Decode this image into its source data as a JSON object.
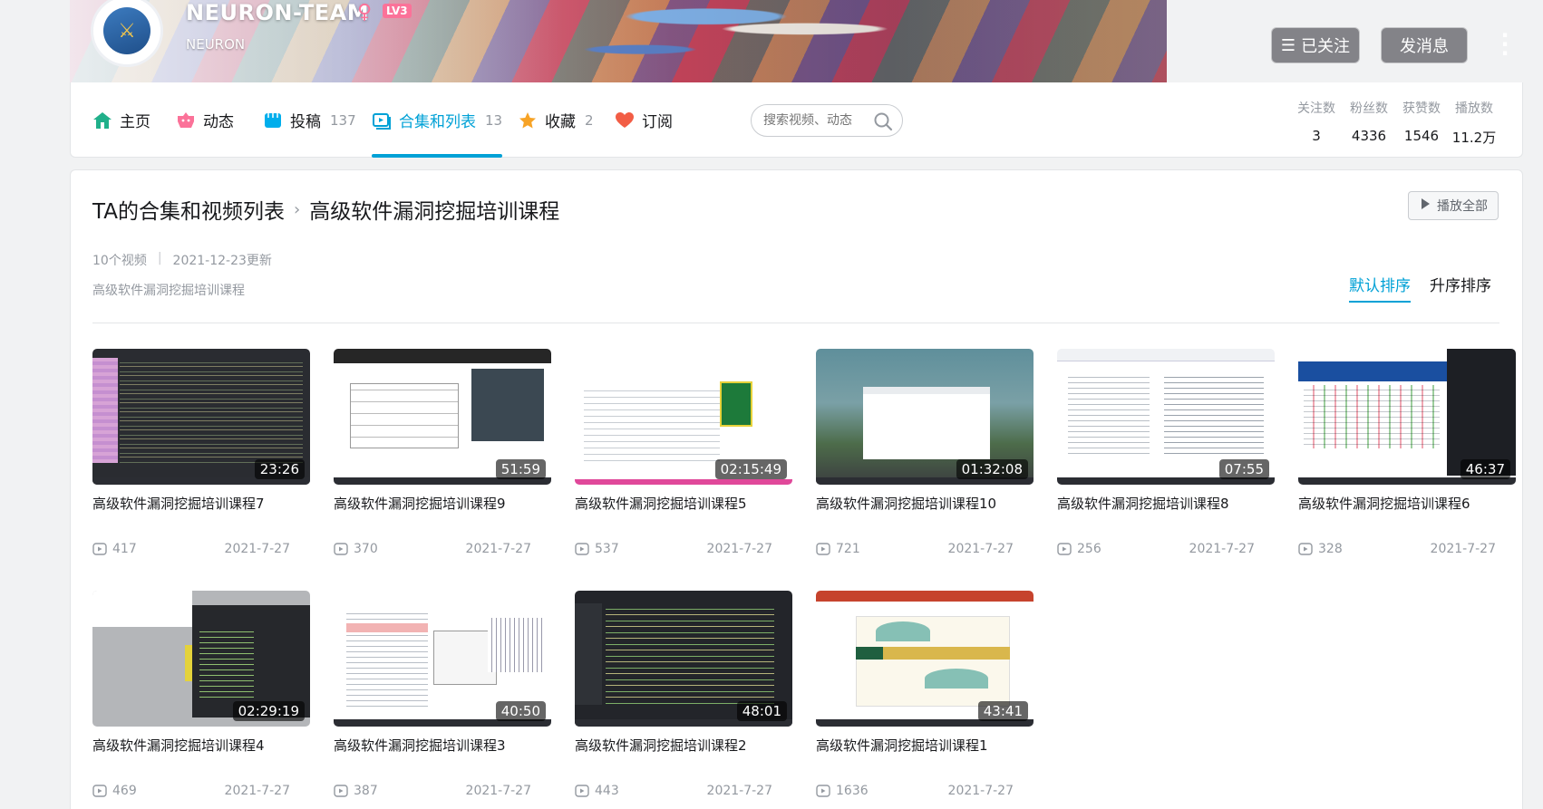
{
  "header": {
    "username": "NEURON-TEAM",
    "level": "LV3",
    "sign": "NEURON",
    "follow_label": "已关注",
    "message_label": "发消息"
  },
  "nav": {
    "items": [
      {
        "label": "主页",
        "count": "",
        "icon": "home-icon"
      },
      {
        "label": "动态",
        "count": "",
        "icon": "feed-icon"
      },
      {
        "label": "投稿",
        "count": "137",
        "icon": "upload-icon"
      },
      {
        "label": "合集和列表",
        "count": "13",
        "icon": "collection-icon",
        "active": true
      },
      {
        "label": "收藏",
        "count": "2",
        "icon": "star-icon"
      },
      {
        "label": "订阅",
        "count": "",
        "icon": "heart-icon"
      }
    ],
    "search_placeholder": "搜索视频、动态"
  },
  "stats": [
    {
      "label": "关注数",
      "value": "3"
    },
    {
      "label": "粉丝数",
      "value": "4336"
    },
    {
      "label": "获赞数",
      "value": "1546"
    },
    {
      "label": "播放数",
      "value": "11.2万"
    }
  ],
  "collection": {
    "breadcrumb_parent": "TA的合集和视频列表",
    "breadcrumb_current": "高级软件漏洞挖掘培训课程",
    "play_all_label": "播放全部",
    "video_count": "10个视频",
    "updated": "2021-12-23更新",
    "description": "高级软件漏洞挖掘培训课程",
    "sort_default": "默认排序",
    "sort_asc": "升序排序"
  },
  "videos": [
    {
      "title": "高级软件漏洞挖掘培训课程7",
      "duration": "23:26",
      "plays": "417",
      "date": "2021-7-27"
    },
    {
      "title": "高级软件漏洞挖掘培训课程9",
      "duration": "51:59",
      "plays": "370",
      "date": "2021-7-27"
    },
    {
      "title": "高级软件漏洞挖掘培训课程5",
      "duration": "02:15:49",
      "plays": "537",
      "date": "2021-7-27"
    },
    {
      "title": "高级软件漏洞挖掘培训课程10",
      "duration": "01:32:08",
      "plays": "721",
      "date": "2021-7-27"
    },
    {
      "title": "高级软件漏洞挖掘培训课程8",
      "duration": "07:55",
      "plays": "256",
      "date": "2021-7-27"
    },
    {
      "title": "高级软件漏洞挖掘培训课程6",
      "duration": "46:37",
      "plays": "328",
      "date": "2021-7-27"
    },
    {
      "title": "高级软件漏洞挖掘培训课程4",
      "duration": "02:29:19",
      "plays": "469",
      "date": "2021-7-27"
    },
    {
      "title": "高级软件漏洞挖掘培训课程3",
      "duration": "40:50",
      "plays": "387",
      "date": "2021-7-27"
    },
    {
      "title": "高级软件漏洞挖掘培训课程2",
      "duration": "48:01",
      "plays": "443",
      "date": "2021-7-27"
    },
    {
      "title": "高级软件漏洞挖掘培训课程1",
      "duration": "43:41",
      "plays": "1636",
      "date": "2021-7-27"
    }
  ],
  "colors": {
    "accent": "#00a1d6",
    "pink": "#fb7299"
  }
}
